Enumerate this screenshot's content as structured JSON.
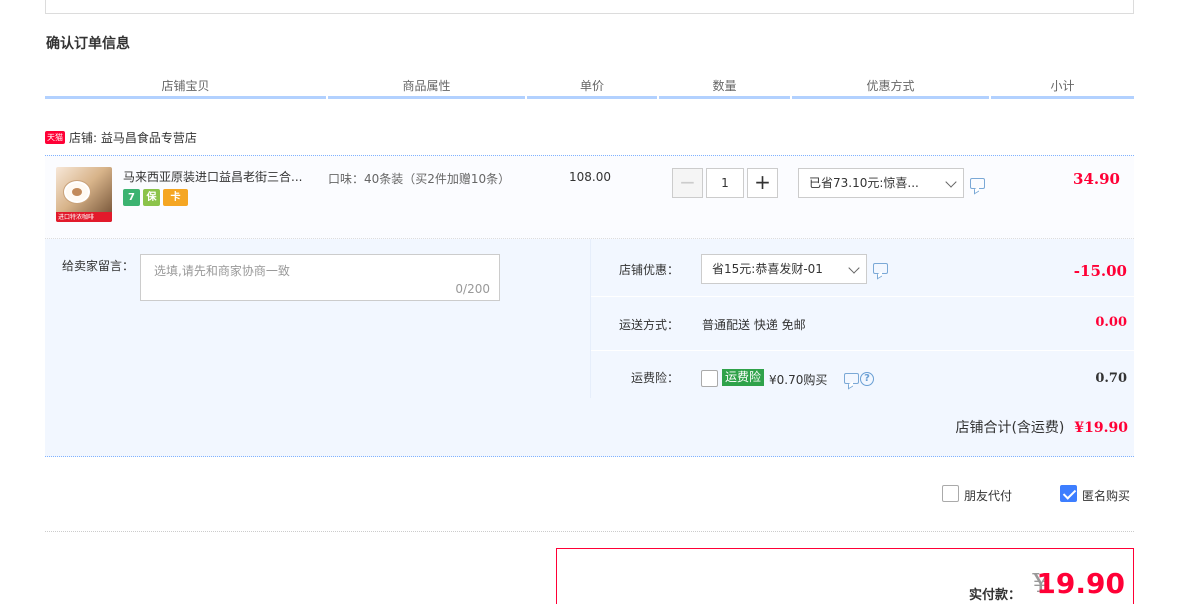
{
  "section_title": "确认订单信息",
  "columns": [
    "店铺宝贝",
    "商品属性",
    "单价",
    "数量",
    "优惠方式",
    "小计"
  ],
  "shop": {
    "badge": "天猫",
    "label": "店铺: 益马昌食品专营店"
  },
  "item": {
    "title": "马来西亚原装进口益昌老街三合...",
    "thumb_tag": "进口特浓咖啡",
    "service_icons": [
      "7",
      "保",
      "卡"
    ],
    "attribute": "口味：40条装（买2件加赠10条）",
    "unit_price": "108.00",
    "quantity": "1",
    "qty_minus": "−",
    "qty_plus": "+",
    "discount_select": "已省73.10元:惊喜...",
    "subtotal": "34.90"
  },
  "message": {
    "label": "给卖家留言：",
    "placeholder": "选填,请先和商家协商一致",
    "count": "0/200"
  },
  "shop_discount": {
    "label": "店铺优惠：",
    "value": "省15元:恭喜发财-01",
    "amount": "-15.00"
  },
  "shipping": {
    "label": "运送方式：",
    "value": "普通配送 快递 免邮",
    "amount": "0.00"
  },
  "insurance": {
    "label": "运费险：",
    "badge": "运费险",
    "value": "¥0.70购买",
    "help": "?",
    "amount": "0.70"
  },
  "shop_total": {
    "label": "店铺合计(含运费)",
    "amount": "¥19.90"
  },
  "friend_pay": {
    "label": "朋友代付",
    "checked": false
  },
  "anonymous": {
    "label": "匿名购买",
    "checked": true
  },
  "payment": {
    "label": "实付款：",
    "currency": "¥",
    "amount": "19.90"
  },
  "colors": {
    "accent_red": "#ff0036",
    "header_underline": "#b2d1ff",
    "panel_bg": "#f2f7ff",
    "checkbox_blue": "#3d7eff",
    "insurance_green": "#2fa24a"
  }
}
